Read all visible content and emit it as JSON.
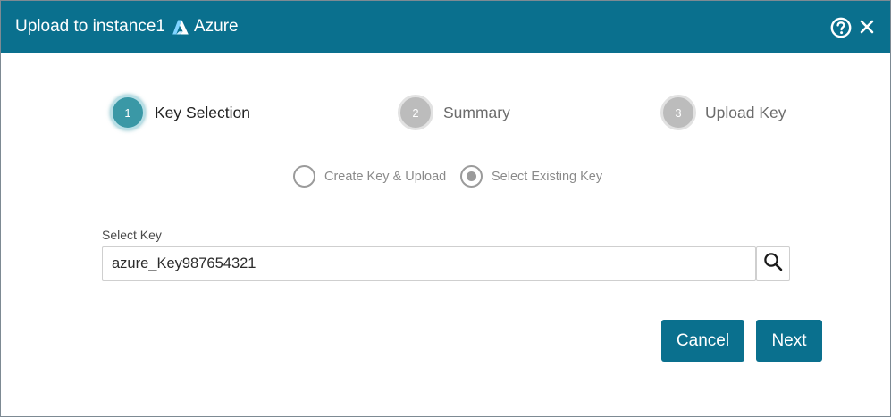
{
  "header": {
    "title": "Upload to instance1",
    "provider": "Azure",
    "colors": {
      "bar": "#0a708e",
      "text": "#ffffff"
    }
  },
  "stepper": {
    "steps": [
      {
        "number": "1",
        "label": "Key Selection",
        "state": "active"
      },
      {
        "number": "2",
        "label": "Summary",
        "state": "inactive"
      },
      {
        "number": "3",
        "label": "Upload Key",
        "state": "inactive"
      }
    ]
  },
  "mode": {
    "options": [
      {
        "label": "Create Key & Upload",
        "selected": false
      },
      {
        "label": "Select Existing Key",
        "selected": true
      }
    ]
  },
  "select_key": {
    "label": "Select Key",
    "value": "azure_Key987654321",
    "search_icon": "search-icon"
  },
  "buttons": {
    "cancel": "Cancel",
    "next": "Next",
    "color": "#0a708e"
  }
}
